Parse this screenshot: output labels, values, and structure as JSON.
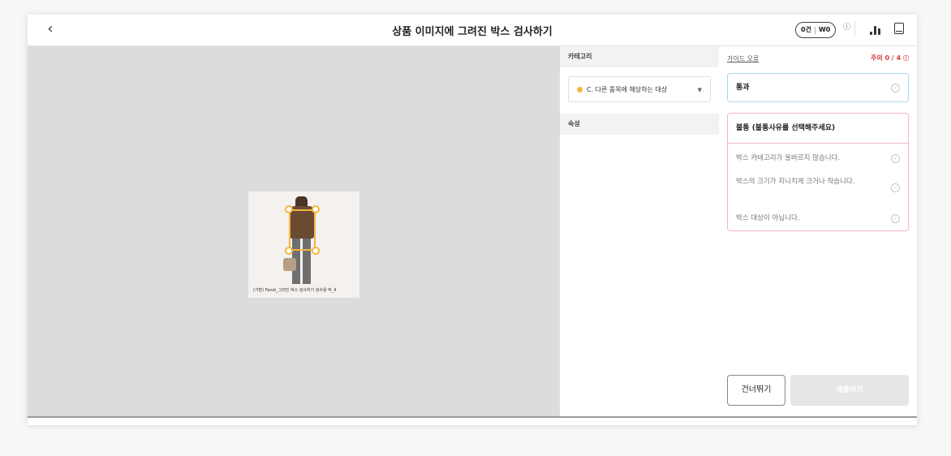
{
  "header": {
    "back_icon": "chevron-left-icon",
    "title": "상품 이미지에 그려진 박스 검사하기",
    "counter_left": "0건",
    "counter_right": "W0",
    "help_icon": "info-circle-icon",
    "stats_icon": "bar-chart-icon",
    "save_icon": "save-icon"
  },
  "canvas": {
    "image_caption": "(가방) Fendi_그려진 박스 검사하기 검수용 박_4",
    "bbox_color": "#f2b63f"
  },
  "category_panel": {
    "category_header": "카테고리",
    "selected_category": "C. 다른 품목에 해당하는 대상",
    "attribute_header": "속성"
  },
  "review_panel": {
    "guide_error_label": "가이드 오류",
    "warning_label": "주의 0 / 4",
    "pass_label": "통과",
    "fail_title": "불통 (불통사유를 선택해주세요)",
    "reasons": [
      "박스 카테고리가 올바르지 않습니다.",
      "박스의 크기가 지나치게 크거나 작습니다.",
      "박스 대상이 아닙니다."
    ],
    "skip_label": "건너뛰기",
    "submit_label": "제출하기",
    "warning_color": "#e03b3b"
  }
}
